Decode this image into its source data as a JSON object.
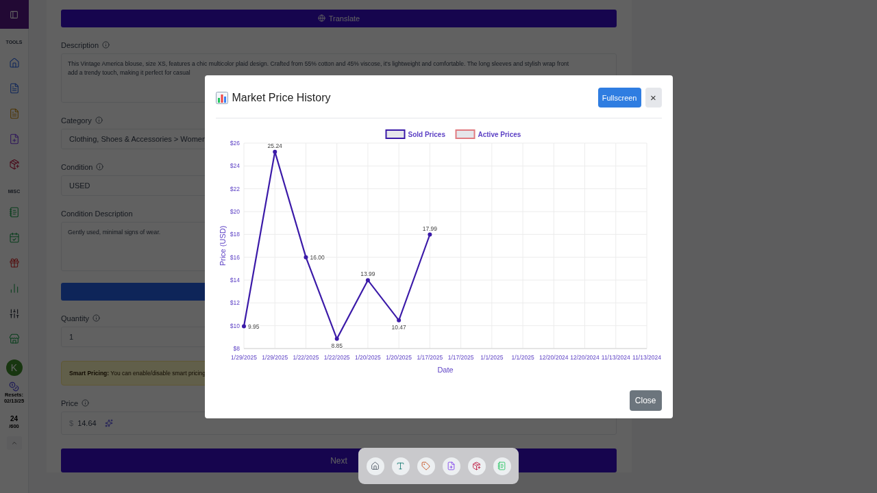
{
  "sidebar": {
    "sections": [
      {
        "label": "TOOLS",
        "items": [
          {
            "kind": "home"
          },
          {
            "kind": "file"
          },
          {
            "kind": "file-draft"
          },
          {
            "kind": "file-plus"
          },
          {
            "kind": "package"
          }
        ]
      },
      {
        "label": "MISC",
        "items": [
          {
            "kind": "notebook"
          },
          {
            "kind": "calendar"
          },
          {
            "kind": "gift"
          },
          {
            "kind": "chart"
          },
          {
            "kind": "sliders"
          },
          {
            "kind": "store"
          }
        ]
      }
    ],
    "avatar": "K",
    "resets_label": "Resets:",
    "resets_date": "02/13/25",
    "credits": "24",
    "credits_total": "/600"
  },
  "form": {
    "translate_button": "Translate",
    "fields": [
      {
        "kind": "textarea",
        "label": "Description",
        "info": true,
        "lines": [
          "This Vintage America blouse, size XS, features a chic multicolor plaid design. Crafted from 55% cotton and 45% viscose, it's lightweight and comfortable. The long sleeves and stylish wrap front",
          "add a trendy touch, making it perfect for casual"
        ]
      },
      {
        "kind": "input",
        "label": "Category",
        "info": true,
        "value": "Clothing, Shoes & Accessories > Women"
      },
      {
        "kind": "input",
        "label": "Condition",
        "info": true,
        "value": "USED"
      },
      {
        "kind": "textarea",
        "label": "Condition Description",
        "info": false,
        "lines": [
          "Gently used, minimal signs of wear."
        ]
      },
      {
        "kind": "button"
      },
      {
        "kind": "input",
        "label": "Quantity",
        "info": true,
        "value": "1"
      },
      {
        "kind": "notice",
        "text": "**Smart Pricing:** You can enable/disable smart pricing"
      },
      {
        "kind": "price",
        "label": "Price",
        "info": true,
        "currency": "$",
        "value": "14.64"
      }
    ],
    "next_button": "Next"
  },
  "modal": {
    "title": "Market Price History",
    "fullscreen_button": "Fullscreen",
    "close_icon": "×",
    "close_button": "Close",
    "chart_data": {
      "type": "line",
      "xlabel": "Date",
      "ylabel": "Price (USD)",
      "categories": [
        "1/29/2025",
        "1/29/2025",
        "1/22/2025",
        "1/22/2025",
        "1/20/2025",
        "1/20/2025",
        "1/17/2025",
        "1/17/2025",
        "1/1/2025",
        "1/1/2025",
        "12/20/2024",
        "12/20/2024",
        "11/13/2024",
        "11/13/2024"
      ],
      "series": [
        {
          "name": "Sold Prices",
          "color": "#3b1aa8",
          "marker": "circle",
          "values": [
            9.95,
            25.24,
            16.0,
            8.85,
            13.99,
            10.47,
            17.99,
            null,
            null,
            null,
            null,
            null,
            null,
            null
          ],
          "value_labels": [
            "9.95",
            "25.24",
            "16.00",
            "8.85",
            "13.99",
            "10.47",
            "17.99",
            null,
            null,
            null,
            null,
            null,
            null,
            null
          ]
        },
        {
          "name": "Active Prices",
          "color": "#e07a80",
          "values": [
            null,
            null,
            null,
            null,
            null,
            null,
            null,
            null,
            null,
            null,
            null,
            null,
            null,
            null
          ]
        }
      ],
      "ylim": [
        8,
        26
      ],
      "grid": true,
      "yticks": [
        {
          "value": 8,
          "label": "$8"
        },
        {
          "value": 10,
          "label": "$10"
        },
        {
          "value": 12,
          "label": "$12"
        },
        {
          "value": 14,
          "label": "$14"
        },
        {
          "value": 16,
          "label": "$16"
        },
        {
          "value": 18,
          "label": "$18"
        },
        {
          "value": 20,
          "label": "$20"
        },
        {
          "value": 22,
          "label": "$22"
        },
        {
          "value": 24,
          "label": "$24"
        },
        {
          "value": 26,
          "label": "$26"
        }
      ]
    }
  },
  "dock": {
    "items": [
      {
        "kind": "home-gray"
      },
      {
        "kind": "text"
      },
      {
        "kind": "tag"
      },
      {
        "kind": "file-plus"
      },
      {
        "kind": "package"
      },
      {
        "kind": "notebook-light"
      }
    ]
  }
}
